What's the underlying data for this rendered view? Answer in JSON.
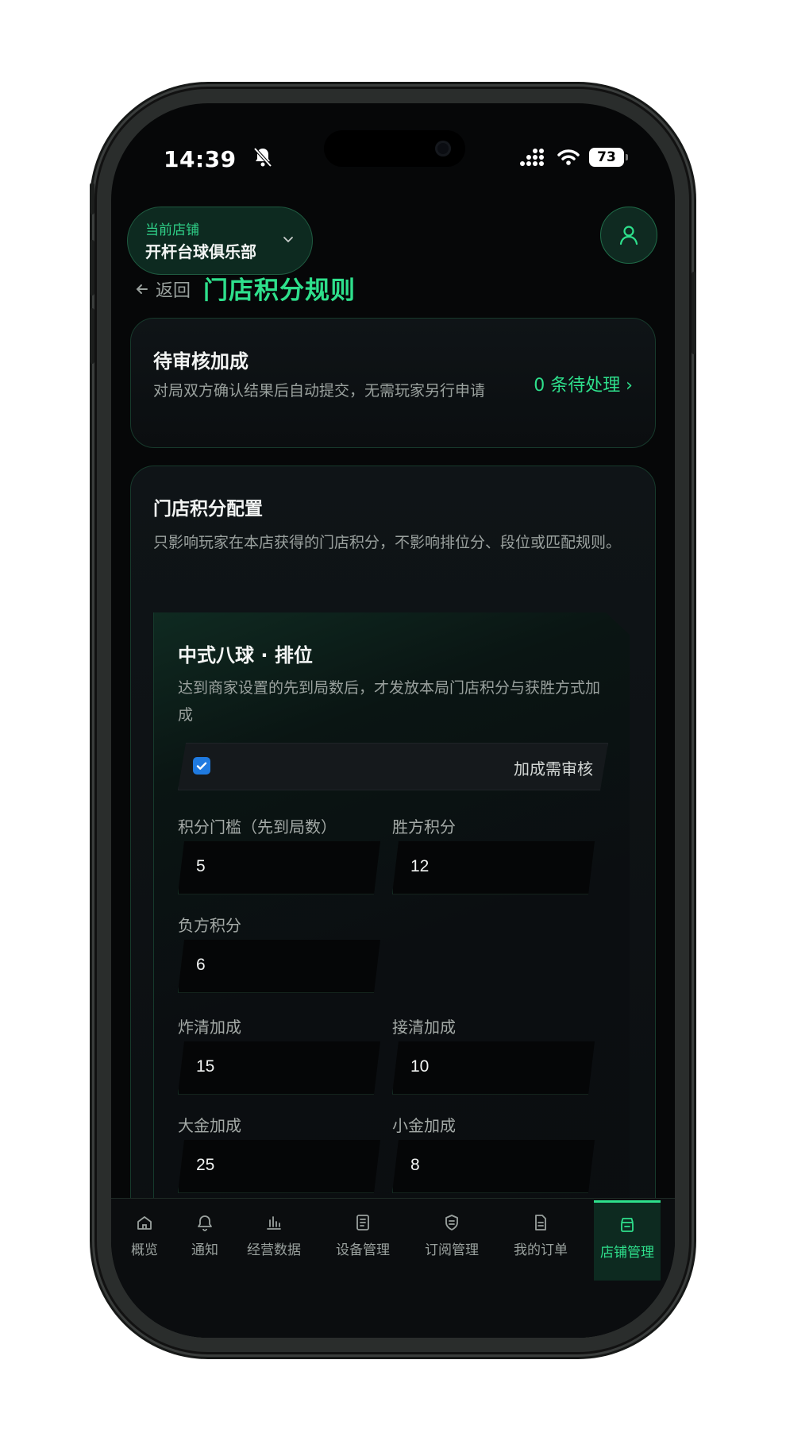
{
  "status": {
    "time": "14:39",
    "battery": "73"
  },
  "store": {
    "label": "当前店铺",
    "name": "开杆台球俱乐部"
  },
  "nav": {
    "back_label": "返回",
    "page_title": "门店积分规则"
  },
  "pending": {
    "title": "待审核加成",
    "desc": "对局双方确认结果后自动提交，无需玩家另行申请",
    "link": "0 条待处理 ›"
  },
  "config": {
    "title": "门店积分配置",
    "desc": "只影响玩家在本店获得的门店积分，不影响排位分、段位或匹配规则。",
    "game": {
      "title": "中式八球 · 排位",
      "desc": "达到商家设置的先到局数后，才发放本局门店积分与获胜方式加成",
      "review_label": "加成需审核",
      "review_checked": true,
      "fields": {
        "threshold": {
          "label": "积分门槛（先到局数）",
          "value": "5"
        },
        "winner": {
          "label": "胜方积分",
          "value": "12"
        },
        "loser": {
          "label": "负方积分",
          "value": "6"
        },
        "break_clear": {
          "label": "炸清加成",
          "value": "15"
        },
        "run_out": {
          "label": "接清加成",
          "value": "10"
        },
        "big_gold": {
          "label": "大金加成",
          "value": "25"
        },
        "small_gold": {
          "label": "小金加成",
          "value": "8"
        }
      }
    }
  },
  "tabs": [
    {
      "label": "概览",
      "icon": "home-icon"
    },
    {
      "label": "通知",
      "icon": "bell-icon"
    },
    {
      "label": "经营数据",
      "icon": "bar-chart-icon"
    },
    {
      "label": "设备管理",
      "icon": "document-icon"
    },
    {
      "label": "订阅管理",
      "icon": "shield-icon"
    },
    {
      "label": "我的订单",
      "icon": "file-icon"
    },
    {
      "label": "店铺管理",
      "icon": "store-icon",
      "active": true
    }
  ],
  "colors": {
    "accent": "#2ee08c",
    "background": "#060708",
    "card_border": "#173a2c"
  }
}
